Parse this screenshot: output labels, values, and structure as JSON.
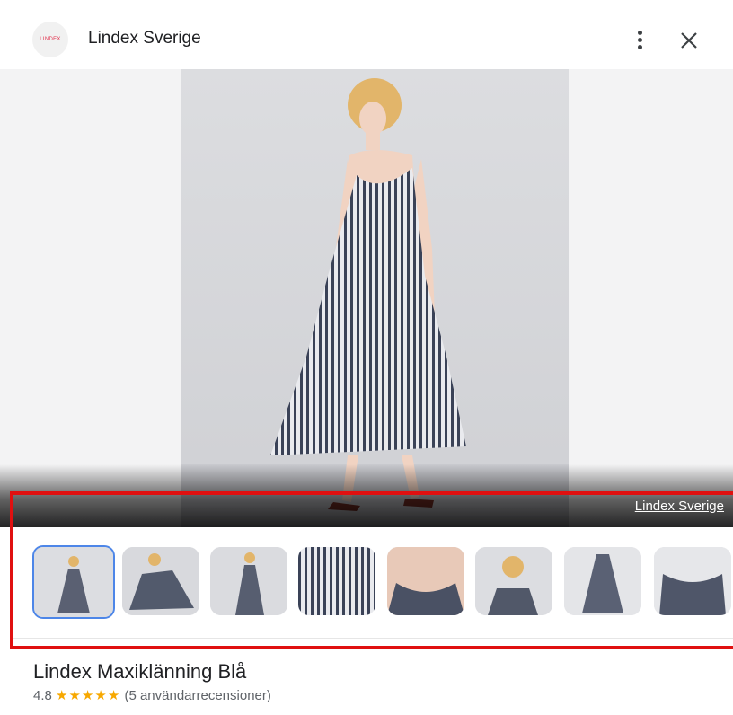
{
  "header": {
    "logo_text": "LINDEX",
    "store_name": "Lindex Sverige",
    "more_icon": "more-vert-icon",
    "close_icon": "close-icon"
  },
  "hero": {
    "source_link": "Lindex Sverige"
  },
  "thumbnails": [
    {
      "name": "thumbnail-1",
      "selected": true
    },
    {
      "name": "thumbnail-2",
      "selected": false
    },
    {
      "name": "thumbnail-3",
      "selected": false
    },
    {
      "name": "thumbnail-4",
      "selected": false
    },
    {
      "name": "thumbnail-5",
      "selected": false
    },
    {
      "name": "thumbnail-6",
      "selected": false
    },
    {
      "name": "thumbnail-7",
      "selected": false
    },
    {
      "name": "thumbnail-8",
      "selected": false
    }
  ],
  "product": {
    "title": "Lindex Maxiklänning Blå",
    "rating_value": "4.8",
    "stars": "★★★★★",
    "review_count": "(5 användarrecensioner)"
  },
  "colors": {
    "accent": "#4d86e8",
    "highlight": "#e01010",
    "star": "#f7a800"
  }
}
